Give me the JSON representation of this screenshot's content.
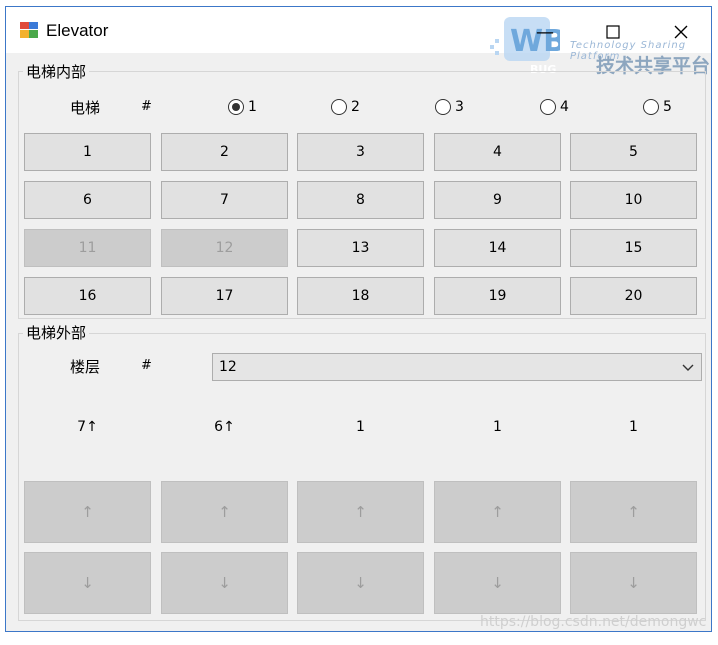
{
  "window": {
    "title": "Elevator",
    "minimize": "—",
    "maximize": "☐",
    "close": "✕"
  },
  "watermark": {
    "tagline": "Technology Sharing Platform",
    "cn_text": "技术共享平台",
    "footer": "https://blog.csdn.net/demongwc"
  },
  "inner": {
    "group_label": "电梯内部",
    "elevator_label": "电梯",
    "hash": "#",
    "radios": [
      "1",
      "2",
      "3",
      "4",
      "5"
    ],
    "selected_radio": "1",
    "floors": [
      "1",
      "2",
      "3",
      "4",
      "5",
      "6",
      "7",
      "8",
      "9",
      "10",
      "11",
      "12",
      "13",
      "14",
      "15",
      "16",
      "17",
      "18",
      "19",
      "20"
    ]
  },
  "outer": {
    "group_label": "电梯外部",
    "floor_label": "楼层",
    "hash": "#",
    "selected_floor": "12",
    "statuses": [
      "7↑",
      "6↑",
      "1",
      "1",
      "1"
    ],
    "up_arrow": "↑",
    "down_arrow": "↓"
  }
}
